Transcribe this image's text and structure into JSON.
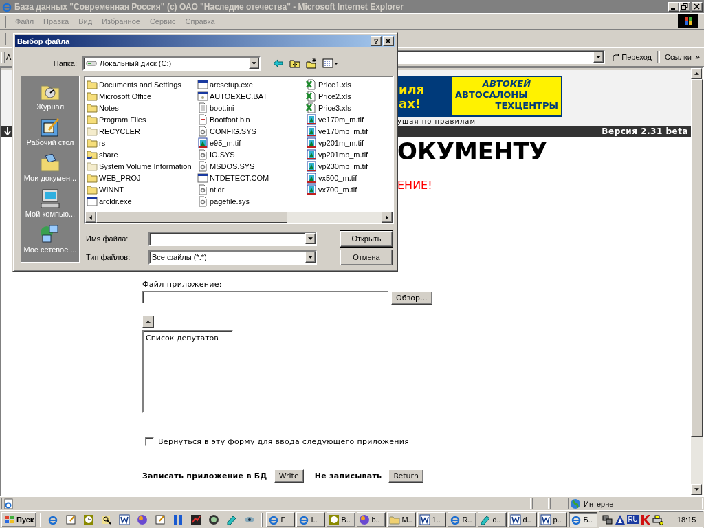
{
  "window": {
    "title": "База данных \"Современная Россия\" (c) ОАО \"Наследие отечества\" - Microsoft Internet Explorer",
    "menu": [
      "Файл",
      "Правка",
      "Вид",
      "Избранное",
      "Сервис",
      "Справка"
    ]
  },
  "address_bar": {
    "label": "А",
    "go_button": "Переход",
    "links": "Ссылки",
    "more": "»"
  },
  "page": {
    "banner_left": [
      "иля",
      "ах!"
    ],
    "banner_logo": "АВТОКЕЙ",
    "banner_lines": [
      "АВТОСАЛОНЫ",
      "ТЕХЦЕНТРЫ"
    ],
    "tagline": "ущая по правилам",
    "version": "Версия 2.31 beta",
    "heading": "ОКУМЕНТУ",
    "warning": "ЕНИЕ!",
    "attachment_label": "Файл-приложение:",
    "browse_button": "Обзор...",
    "list_items": [
      "Список депутатов"
    ],
    "return_checkbox": {
      "label": "Вернуться в эту форму для ввода следующего приложения",
      "checked": false
    },
    "save_label": "Записать приложение в БД",
    "write_button": "Write",
    "skip_label": "Не записывать",
    "return_button": "Return"
  },
  "status_bar": {
    "zone": "Интернет"
  },
  "dialog": {
    "title": "Выбор файла",
    "help": "?",
    "folder_label": "Папка:",
    "folder": "Локальный диск (C:)",
    "places": [
      {
        "label": "Журнал",
        "kind": "history"
      },
      {
        "label": "Рабочий стол",
        "kind": "desktop"
      },
      {
        "label": "Мои докумен...",
        "kind": "documents"
      },
      {
        "label": "Мой компью...",
        "kind": "computer"
      },
      {
        "label": "Мое сетевое ...",
        "kind": "network"
      }
    ],
    "files": [
      {
        "name": "Documents and Settings",
        "kind": "folder"
      },
      {
        "name": "Microsoft Office",
        "kind": "folder"
      },
      {
        "name": "Notes",
        "kind": "folder"
      },
      {
        "name": "Program Files",
        "kind": "folder"
      },
      {
        "name": "RECYCLER",
        "kind": "hidden-folder"
      },
      {
        "name": "rs",
        "kind": "folder"
      },
      {
        "name": "share",
        "kind": "shared-folder"
      },
      {
        "name": "System Volume Information",
        "kind": "hidden-folder"
      },
      {
        "name": "WEB_PROJ",
        "kind": "folder"
      },
      {
        "name": "WINNT",
        "kind": "folder"
      },
      {
        "name": "arcldr.exe",
        "kind": "exe"
      },
      {
        "name": "arcsetup.exe",
        "kind": "exe"
      },
      {
        "name": "AUTOEXEC.BAT",
        "kind": "bat"
      },
      {
        "name": "boot.ini",
        "kind": "ini"
      },
      {
        "name": "Bootfont.bin",
        "kind": "bin"
      },
      {
        "name": "CONFIG.SYS",
        "kind": "sys"
      },
      {
        "name": "e95_m.tif",
        "kind": "tif"
      },
      {
        "name": "IO.SYS",
        "kind": "sys"
      },
      {
        "name": "MSDOS.SYS",
        "kind": "sys"
      },
      {
        "name": "NTDETECT.COM",
        "kind": "exe"
      },
      {
        "name": "ntldr",
        "kind": "sys"
      },
      {
        "name": "pagefile.sys",
        "kind": "sys"
      },
      {
        "name": "Price1.xls",
        "kind": "xls"
      },
      {
        "name": "Price2.xls",
        "kind": "xls"
      },
      {
        "name": "Price3.xls",
        "kind": "xls"
      },
      {
        "name": "ve170m_m.tif",
        "kind": "tif"
      },
      {
        "name": "ve170mb_m.tif",
        "kind": "tif"
      },
      {
        "name": "vp201m_m.tif",
        "kind": "tif"
      },
      {
        "name": "vp201mb_m.tif",
        "kind": "tif"
      },
      {
        "name": "vp230mb_m.tif",
        "kind": "tif"
      },
      {
        "name": "vx500_m.tif",
        "kind": "tif"
      },
      {
        "name": "vx700_m.tif",
        "kind": "tif"
      }
    ],
    "filename_label": "Имя файла:",
    "filetype_label": "Тип файлов:",
    "filetype": "Все файлы (*.*)",
    "open_button": "Открыть",
    "cancel_button": "Отмена"
  },
  "taskbar": {
    "start": "Пуск",
    "tasks": [
      {
        "label": "Г..",
        "kind": "ie",
        "selected": false
      },
      {
        "label": "I..",
        "kind": "ie",
        "selected": false
      },
      {
        "label": "B..",
        "kind": "clock",
        "selected": false
      },
      {
        "label": "b..",
        "kind": "globe",
        "selected": false
      },
      {
        "label": "M..",
        "kind": "folder",
        "selected": false
      },
      {
        "label": "1..",
        "kind": "word",
        "selected": false
      },
      {
        "label": "R..",
        "kind": "ie",
        "selected": false
      },
      {
        "label": "d..",
        "kind": "book",
        "selected": false
      },
      {
        "label": "d..",
        "kind": "word",
        "selected": false
      },
      {
        "label": "p..",
        "kind": "word",
        "selected": false
      },
      {
        "label": "Б..",
        "kind": "ie",
        "selected": true
      }
    ],
    "language": "RU",
    "clock": "18:15"
  }
}
